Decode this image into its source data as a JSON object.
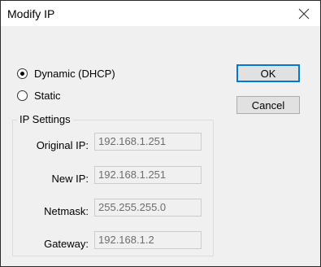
{
  "window": {
    "title": "Modify IP"
  },
  "mode": {
    "options": [
      {
        "label": "Dynamic (DHCP)",
        "selected": true
      },
      {
        "label": "Static",
        "selected": false
      }
    ]
  },
  "buttons": {
    "ok": "OK",
    "cancel": "Cancel"
  },
  "ip_settings": {
    "title": "IP Settings",
    "fields": [
      {
        "label": "Original IP:",
        "value": "192.168.1.251"
      },
      {
        "label": "New IP:",
        "value": "192.168.1.251"
      },
      {
        "label": "Netmask:",
        "value": "255.255.255.0"
      },
      {
        "label": "Gateway:",
        "value": "192.168.1.2"
      }
    ]
  }
}
